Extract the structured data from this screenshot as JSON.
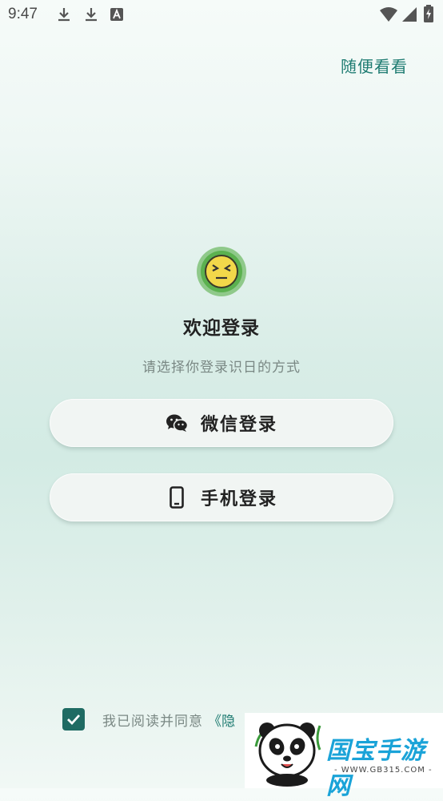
{
  "status_bar": {
    "time": "9:47",
    "icons": [
      "download-icon",
      "download-icon",
      "font-a-icon",
      "wifi-icon",
      "signal-icon",
      "battery-icon"
    ]
  },
  "header": {
    "browse_label": "随便看看"
  },
  "main": {
    "logo_icon": "emoji-face-icon",
    "title": "欢迎登录",
    "subtitle": "请选择你登录识日的方式",
    "wechat_button": {
      "label": "微信登录",
      "icon": "wechat-icon"
    },
    "phone_button": {
      "label": "手机登录",
      "icon": "phone-icon"
    }
  },
  "footer": {
    "agreement_checked": true,
    "agreement_text": "我已阅读并同意",
    "agreement_link": "《隐"
  },
  "watermark": {
    "brand": "国宝手游网",
    "url": "- WWW.GB315.COM -"
  },
  "colors": {
    "accent": "#1f7c72",
    "checkbox": "#1f6b63",
    "button_bg": "#f1f5f3"
  }
}
